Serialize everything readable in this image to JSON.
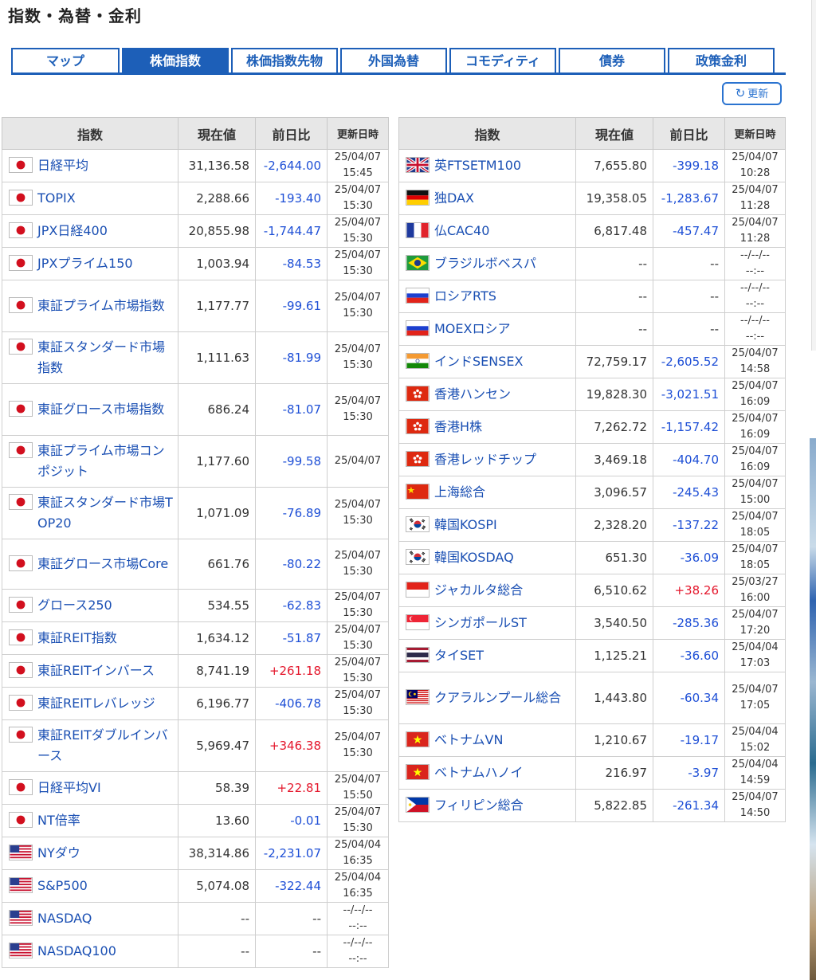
{
  "page_title": "指数・為替・金利",
  "tabs": [
    {
      "label": "マップ",
      "active": false
    },
    {
      "label": "株価指数",
      "active": true
    },
    {
      "label": "株価指数先物",
      "active": false
    },
    {
      "label": "外国為替",
      "active": false
    },
    {
      "label": "コモディティ",
      "active": false
    },
    {
      "label": "債券",
      "active": false
    },
    {
      "label": "政策金利",
      "active": false
    }
  ],
  "refresh": {
    "icon": "refresh-icon",
    "label": "更新"
  },
  "headers": {
    "name": "指数",
    "value": "現在値",
    "change": "前日比",
    "updated": "更新日時"
  },
  "colors": {
    "accent": "#1d5fb8",
    "link": "#1a4fb3",
    "negative": "#1e4fd6",
    "positive": "#e4162b",
    "header_bg": "#e7e7e7"
  },
  "left_rows": [
    {
      "flag": "jp",
      "name": "日経平均",
      "value": "31,136.58",
      "change": "-2,644.00",
      "d1": "25/04/07",
      "d2": "15:45"
    },
    {
      "flag": "jp",
      "name": "TOPIX",
      "value": "2,288.66",
      "change": "-193.40",
      "d1": "25/04/07",
      "d2": "15:30"
    },
    {
      "flag": "jp",
      "name": "JPX日経400",
      "value": "20,855.98",
      "change": "-1,744.47",
      "d1": "25/04/07",
      "d2": "15:30"
    },
    {
      "flag": "jp",
      "name": "JPXプライム150",
      "value": "1,003.94",
      "change": "-84.53",
      "d1": "25/04/07",
      "d2": "15:30"
    },
    {
      "flag": "jp",
      "name": "東証プライム市場指数",
      "value": "1,177.77",
      "change": "-99.61",
      "d1": "25/04/07",
      "d2": "15:30"
    },
    {
      "flag": "jp",
      "name": "東証スタンダード市場指数",
      "value": "1,111.63",
      "change": "-81.99",
      "d1": "25/04/07",
      "d2": "15:30"
    },
    {
      "flag": "jp",
      "name": "東証グロース市場指数",
      "value": "686.24",
      "change": "-81.07",
      "d1": "25/04/07",
      "d2": "15:30"
    },
    {
      "flag": "jp",
      "name": "東証プライム市場コンポジット",
      "value": "1,177.60",
      "change": "-99.58",
      "d1": "25/04/07",
      "d2": ""
    },
    {
      "flag": "jp",
      "name": "東証スタンダード市場TOP20",
      "value": "1,071.09",
      "change": "-76.89",
      "d1": "25/04/07",
      "d2": "15:30"
    },
    {
      "flag": "jp",
      "name": "東証グロース市場Core",
      "value": "661.76",
      "change": "-80.22",
      "d1": "25/04/07",
      "d2": "15:30"
    },
    {
      "flag": "jp",
      "name": "グロース250",
      "value": "534.55",
      "change": "-62.83",
      "d1": "25/04/07",
      "d2": "15:30"
    },
    {
      "flag": "jp",
      "name": "東証REIT指数",
      "value": "1,634.12",
      "change": "-51.87",
      "d1": "25/04/07",
      "d2": "15:30"
    },
    {
      "flag": "jp",
      "name": "東証REITインバース",
      "value": "8,741.19",
      "change": "+261.18",
      "d1": "25/04/07",
      "d2": "15:30"
    },
    {
      "flag": "jp",
      "name": "東証REITレバレッジ",
      "value": "6,196.77",
      "change": "-406.78",
      "d1": "25/04/07",
      "d2": "15:30"
    },
    {
      "flag": "jp",
      "name": "東証REITダブルインバース",
      "value": "5,969.47",
      "change": "+346.38",
      "d1": "25/04/07",
      "d2": "15:30"
    },
    {
      "flag": "jp",
      "name": "日経平均VI",
      "value": "58.39",
      "change": "+22.81",
      "d1": "25/04/07",
      "d2": "15:50"
    },
    {
      "flag": "jp",
      "name": "NT倍率",
      "value": "13.60",
      "change": "-0.01",
      "d1": "25/04/07",
      "d2": "15:30"
    },
    {
      "flag": "us",
      "name": "NYダウ",
      "value": "38,314.86",
      "change": "-2,231.07",
      "d1": "25/04/04",
      "d2": "16:35"
    },
    {
      "flag": "us",
      "name": "S&P500",
      "value": "5,074.08",
      "change": "-322.44",
      "d1": "25/04/04",
      "d2": "16:35"
    },
    {
      "flag": "us",
      "name": "NASDAQ",
      "value": "--",
      "change": "--",
      "d1": "--/--/--",
      "d2": "--:--"
    },
    {
      "flag": "us",
      "name": "NASDAQ100",
      "value": "--",
      "change": "--",
      "d1": "--/--/--",
      "d2": "--:--"
    }
  ],
  "right_rows": [
    {
      "flag": "gb",
      "name": "英FTSETM100",
      "value": "7,655.80",
      "change": "-399.18",
      "d1": "25/04/07",
      "d2": "10:28"
    },
    {
      "flag": "de",
      "name": "独DAX",
      "value": "19,358.05",
      "change": "-1,283.67",
      "d1": "25/04/07",
      "d2": "11:28"
    },
    {
      "flag": "fr",
      "name": "仏CAC40",
      "value": "6,817.48",
      "change": "-457.47",
      "d1": "25/04/07",
      "d2": "11:28"
    },
    {
      "flag": "br",
      "name": "ブラジルボベスパ",
      "value": "--",
      "change": "--",
      "d1": "--/--/--",
      "d2": "--:--"
    },
    {
      "flag": "ru",
      "name": "ロシアRTS",
      "value": "--",
      "change": "--",
      "d1": "--/--/--",
      "d2": "--:--"
    },
    {
      "flag": "ru",
      "name": "MOEXロシア",
      "value": "--",
      "change": "--",
      "d1": "--/--/--",
      "d2": "--:--"
    },
    {
      "flag": "in",
      "name": "インドSENSEX",
      "value": "72,759.17",
      "change": "-2,605.52",
      "d1": "25/04/07",
      "d2": "14:58"
    },
    {
      "flag": "hk",
      "name": "香港ハンセン",
      "value": "19,828.30",
      "change": "-3,021.51",
      "d1": "25/04/07",
      "d2": "16:09"
    },
    {
      "flag": "hk",
      "name": "香港H株",
      "value": "7,262.72",
      "change": "-1,157.42",
      "d1": "25/04/07",
      "d2": "16:09"
    },
    {
      "flag": "hk",
      "name": "香港レッドチップ",
      "value": "3,469.18",
      "change": "-404.70",
      "d1": "25/04/07",
      "d2": "16:09"
    },
    {
      "flag": "cn",
      "name": "上海総合",
      "value": "3,096.57",
      "change": "-245.43",
      "d1": "25/04/07",
      "d2": "15:00"
    },
    {
      "flag": "kr",
      "name": "韓国KOSPI",
      "value": "2,328.20",
      "change": "-137.22",
      "d1": "25/04/07",
      "d2": "18:05"
    },
    {
      "flag": "kr",
      "name": "韓国KOSDAQ",
      "value": "651.30",
      "change": "-36.09",
      "d1": "25/04/07",
      "d2": "18:05"
    },
    {
      "flag": "id",
      "name": "ジャカルタ総合",
      "value": "6,510.62",
      "change": "+38.26",
      "d1": "25/03/27",
      "d2": "16:00"
    },
    {
      "flag": "sg",
      "name": "シンガポールST",
      "value": "3,540.50",
      "change": "-285.36",
      "d1": "25/04/07",
      "d2": "17:20"
    },
    {
      "flag": "th",
      "name": "タイSET",
      "value": "1,125.21",
      "change": "-36.60",
      "d1": "25/04/04",
      "d2": "17:03"
    },
    {
      "flag": "my",
      "name": "クアラルンプール総合",
      "value": "1,443.80",
      "change": "-60.34",
      "d1": "25/04/07",
      "d2": "17:05"
    },
    {
      "flag": "vn",
      "name": "ベトナムVN",
      "value": "1,210.67",
      "change": "-19.17",
      "d1": "25/04/04",
      "d2": "15:02"
    },
    {
      "flag": "vn",
      "name": "ベトナムハノイ",
      "value": "216.97",
      "change": "-3.97",
      "d1": "25/04/04",
      "d2": "14:59"
    },
    {
      "flag": "ph",
      "name": "フィリピン総合",
      "value": "5,822.85",
      "change": "-261.34",
      "d1": "25/04/07",
      "d2": "14:50"
    }
  ]
}
